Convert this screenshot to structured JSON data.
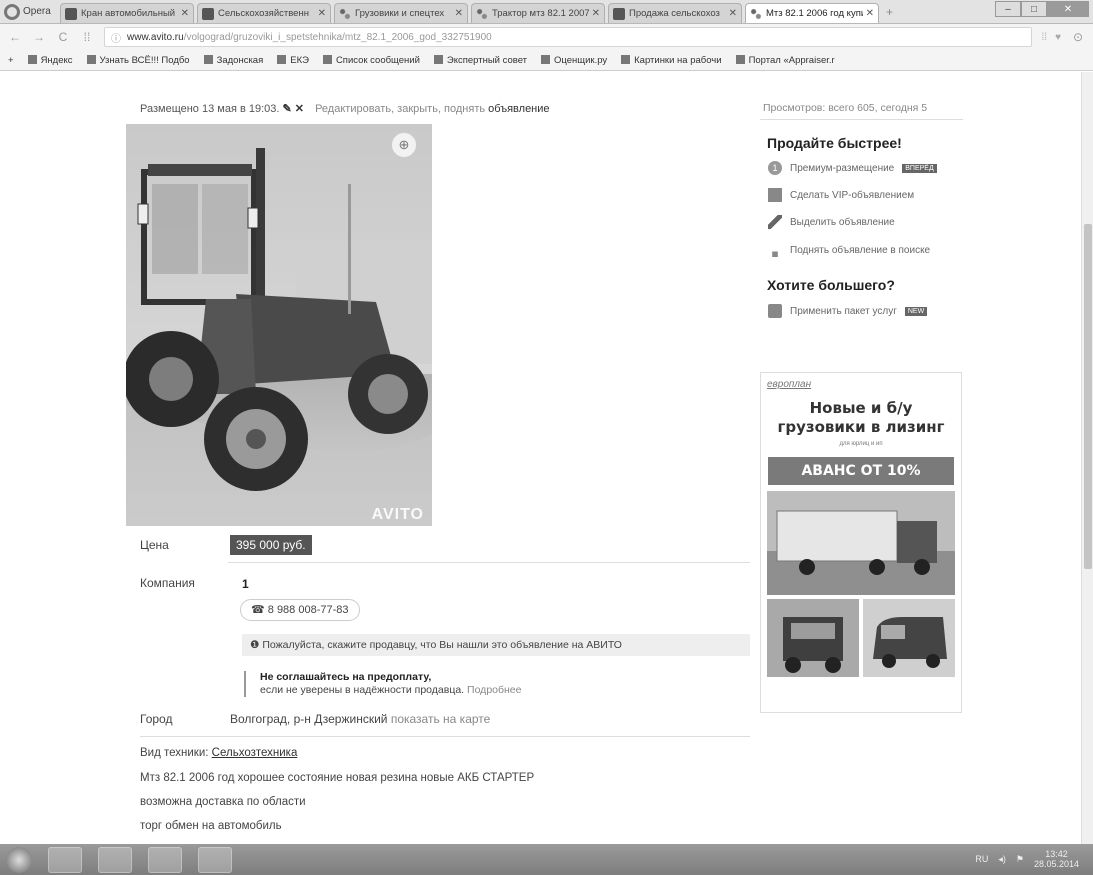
{
  "browser": {
    "opera_label": "Opera",
    "tabs": [
      {
        "title": "Кран автомобильный"
      },
      {
        "title": "Сельскохозяйственн"
      },
      {
        "title": "Грузовики и спецтех"
      },
      {
        "title": "Трактор мтз 82.1 2007"
      },
      {
        "title": "Продажа сельскохоз"
      },
      {
        "title": "Мтз 82.1 2006 год купи"
      }
    ],
    "url_host": "www.avito.ru",
    "url_path": "/volgograd/gruzoviki_i_spetstehnika/mtz_82.1_2006_god_332751900",
    "bookmarks": [
      "Яндекс",
      "Узнать ВСЁ!!! Подбо",
      "Задонская",
      "ЕКЭ",
      "Список сообщений",
      "Экспертный совет",
      "Оценщик.ру",
      "Картинки на рабочи",
      "Портал «Appraiser.r"
    ]
  },
  "listing": {
    "posted": "Размещено 13 мая в 19:03.",
    "edit_text": "Редактировать, закрыть, поднять",
    "edit_bold": "объявление",
    "watermark": "AVITO",
    "price_label": "Цена",
    "price": "395 000 руб.",
    "company_label": "Компания",
    "company": "1",
    "phone": "8 988 008-77-83",
    "notice": "Пожалуйста, скажите продавцу, что Вы нашли это объявление на АВИТО",
    "warn_title": "Не соглашайтесь на предоплату,",
    "warn_text": "если не уверены в надёжности продавца.",
    "warn_more": "Подробнее",
    "city_label": "Город",
    "city": "Волгоград, р-н Дзержинский",
    "map_link": "показать на карте",
    "type_label": "Вид техники:",
    "type_value": "Сельхозтехника",
    "desc1": "Мтз 82.1 2006 год хорошее состояние новая резина новые АКБ СТАРТЕР",
    "desc2": "возможна доставка по области",
    "desc3": "торг обмен на автомобиль"
  },
  "sidebar": {
    "views": "Просмотров: всего 605, сегодня 5",
    "sell_faster": "Продайте быстрее!",
    "items": [
      {
        "label": "Премиум-размещение",
        "tag": "ВПЕРЁД"
      },
      {
        "label": "Сделать VIP-объявлением"
      },
      {
        "label": "Выделить объявление"
      },
      {
        "label": "Поднять объявление в поиске"
      }
    ],
    "want_more": "Хотите большего?",
    "package": "Применить пакет услуг",
    "package_tag": "NEW"
  },
  "ad": {
    "brand": "европлан",
    "title1": "Новые и б/у",
    "title2": "грузовики в лизинг",
    "sub": "для юрлиц и ип",
    "cta": "АВАНС ОТ 10%"
  },
  "taskbar": {
    "lang": "RU",
    "time": "13:42",
    "date": "28.05.2014"
  }
}
